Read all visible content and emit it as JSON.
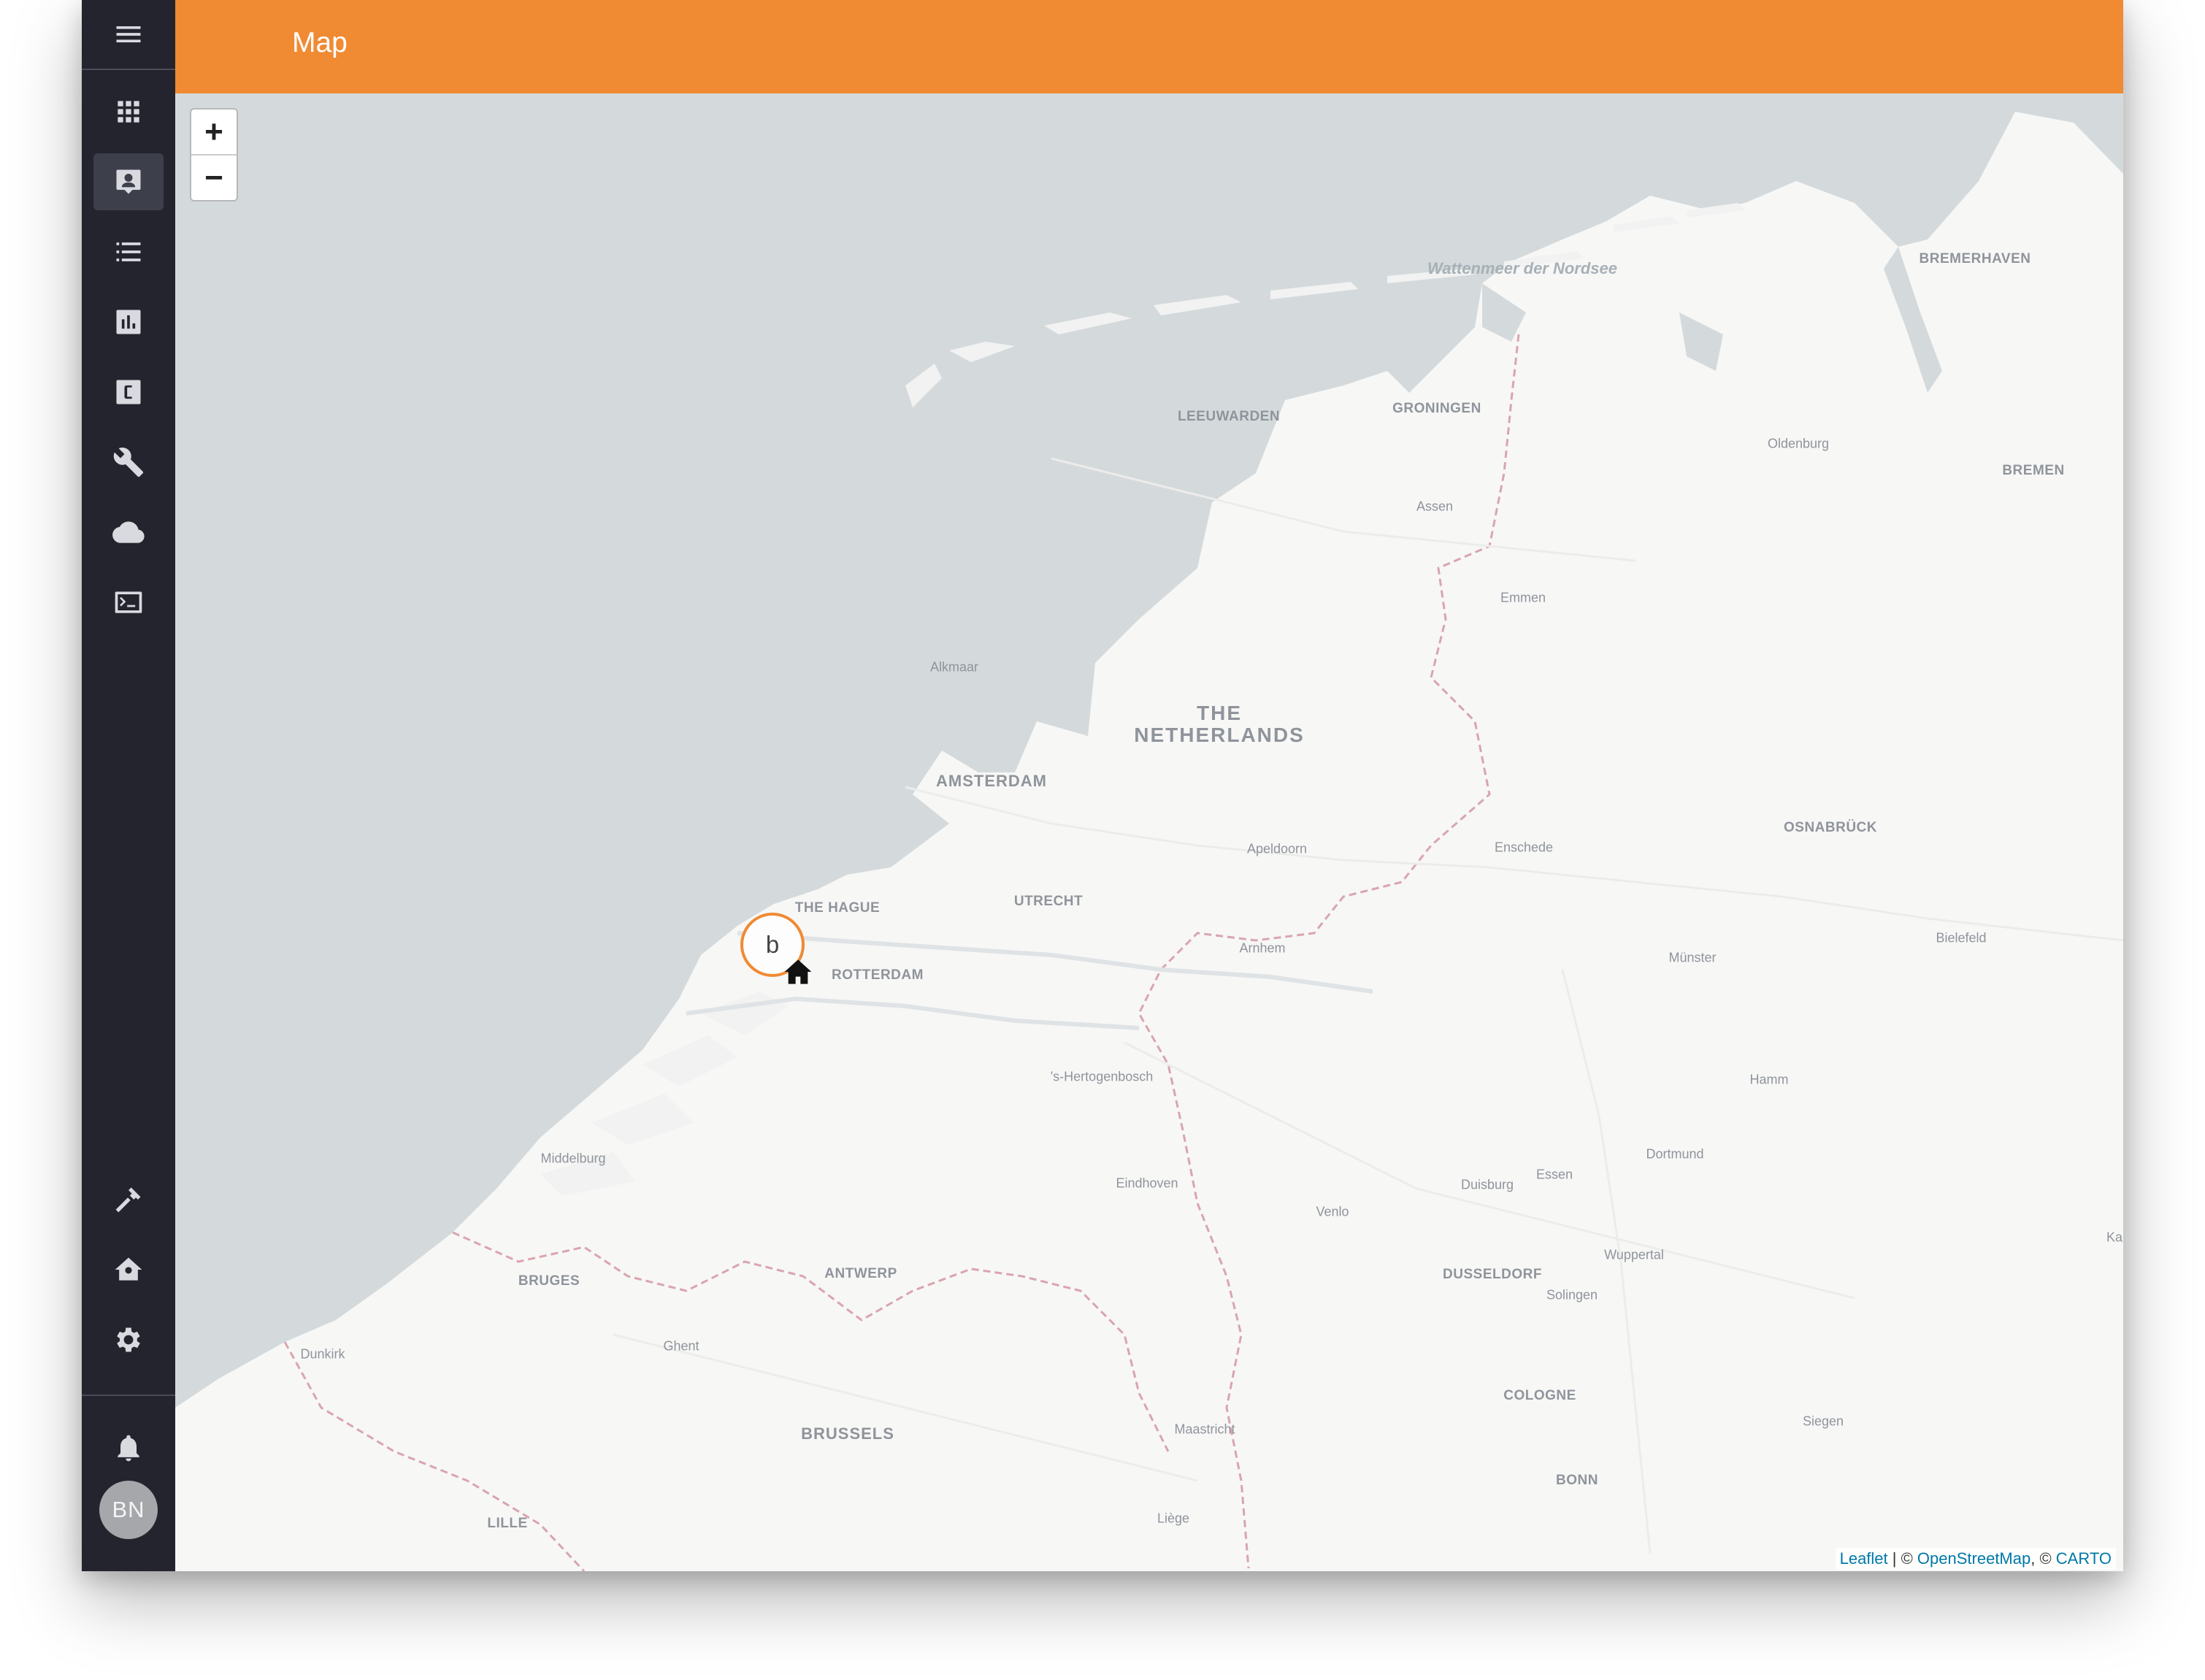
{
  "app": {
    "page_title": "Map",
    "user_initials": "BN"
  },
  "sidebar": {
    "items": [
      {
        "name": "menu",
        "icon": "hamburger-menu-icon"
      },
      {
        "name": "dashboard",
        "icon": "apps-grid-icon"
      },
      {
        "name": "map",
        "icon": "contact-card-icon",
        "active": true
      },
      {
        "name": "list",
        "icon": "list-icon"
      },
      {
        "name": "charts",
        "icon": "bar-chart-icon"
      },
      {
        "name": "c-module",
        "icon": "letter-c-icon"
      },
      {
        "name": "tools",
        "icon": "wrench-icon"
      },
      {
        "name": "cloud",
        "icon": "cloud-icon"
      },
      {
        "name": "terminal",
        "icon": "terminal-icon"
      },
      {
        "name": "build",
        "icon": "hammer-icon"
      },
      {
        "name": "home-settings",
        "icon": "house-gear-icon"
      },
      {
        "name": "settings",
        "icon": "gear-icon"
      },
      {
        "name": "notifications",
        "icon": "bell-icon"
      }
    ]
  },
  "map": {
    "zoom_in": "+",
    "zoom_out": "−",
    "marker_label": "b",
    "attribution": {
      "leaflet": "Leaflet",
      "sep1": " | © ",
      "osm": "OpenStreetMap",
      "sep2": ", © ",
      "carto": "CARTO"
    },
    "labels": {
      "wadden": "Wattenmeer der Nordsee",
      "bremerhaven": "BREMERHAVEN",
      "leeuwarden": "LEEUWARDEN",
      "groningen": "GRONINGEN",
      "oldenburg": "Oldenburg",
      "bremen": "BREMEN",
      "assen": "Assen",
      "emmen": "Emmen",
      "alkmaar": "Alkmaar",
      "netherlands": "THE NETHERLANDS",
      "amsterdam": "AMSTERDAM",
      "osnabruck": "OSNABRÜCK",
      "apeldoorn": "Apeldoorn",
      "enschede": "Enschede",
      "the_hague": "THE HAGUE",
      "utrecht": "UTRECHT",
      "rotterdam": "ROTTERDAM",
      "bielefeld": "Bielefeld",
      "arnhem": "Arnhem",
      "munster": "Münster",
      "hertogenbosch": "'s-Hertogenbosch",
      "hamm": "Hamm",
      "middelburg": "Middelburg",
      "dortmund": "Dortmund",
      "eindhoven": "Eindhoven",
      "duisburg": "Duisburg",
      "essen": "Essen",
      "venlo": "Venlo",
      "ka": "Ka",
      "bruges": "BRUGES",
      "antwerp": "ANTWERP",
      "wuppertal": "Wuppertal",
      "dusseldorf": "DUSSELDORF",
      "solingen": "Solingen",
      "dunkirk": "Dunkirk",
      "ghent": "Ghent",
      "cologne": "COLOGNE",
      "siegen": "Siegen",
      "brussels": "BRUSSELS",
      "maastricht": "Maastricht",
      "bonn": "BONN",
      "lille": "LILLE",
      "liege": "Liège"
    }
  },
  "colors": {
    "header": "#f08a33",
    "sidebar": "#23242e",
    "sea": "#d4dadc",
    "land": "#f7f7f6",
    "marker_border": "#f08a33"
  }
}
